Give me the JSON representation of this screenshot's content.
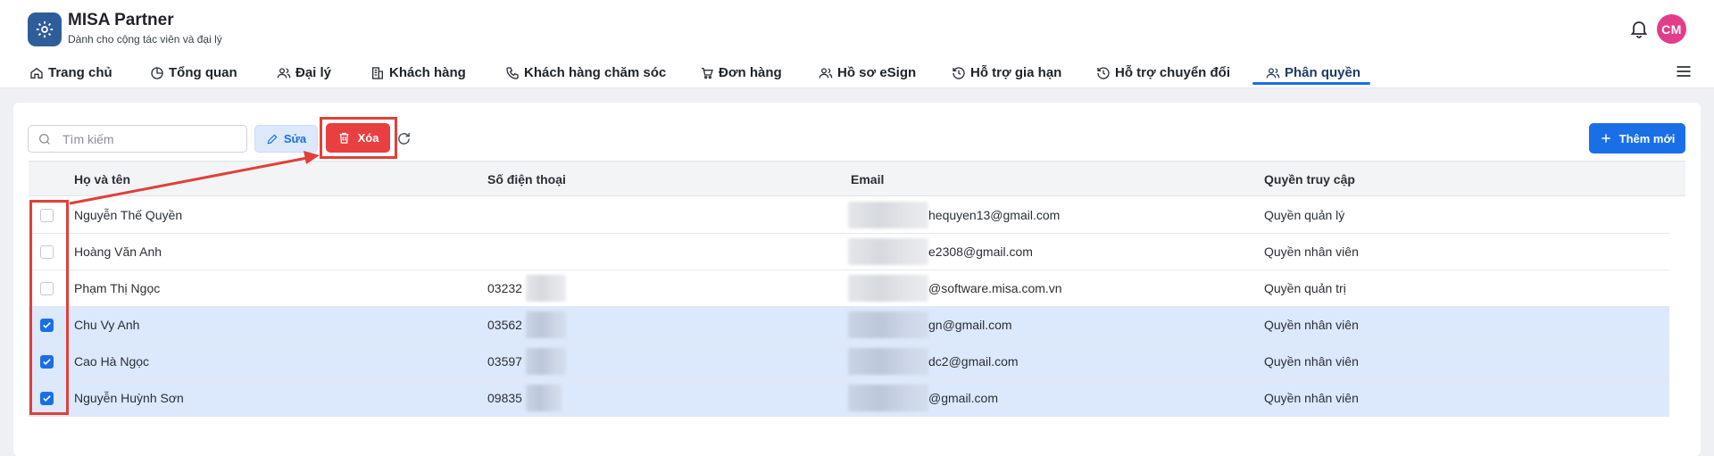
{
  "app": {
    "title": "MISA Partner",
    "subtitle": "Dành cho cộng tác viên và đại lý",
    "avatar_initials": "CM"
  },
  "nav": {
    "items": [
      {
        "label": "Trang chủ",
        "icon": "home-icon"
      },
      {
        "label": "Tổng quan",
        "icon": "pie-chart-icon"
      },
      {
        "label": "Đại lý",
        "icon": "users-icon"
      },
      {
        "label": "Khách hàng",
        "icon": "building-icon"
      },
      {
        "label": "Khách hàng chăm sóc",
        "icon": "phone-icon"
      },
      {
        "label": "Đơn hàng",
        "icon": "cart-icon"
      },
      {
        "label": "Hồ sơ eSign",
        "icon": "users-icon"
      },
      {
        "label": "Hỗ trợ gia hạn",
        "icon": "history-icon"
      },
      {
        "label": "Hỗ trợ chuyển đổi",
        "icon": "history-icon"
      },
      {
        "label": "Phân quyền",
        "icon": "users-icon"
      }
    ],
    "active": "Phân quyền"
  },
  "toolbar": {
    "search_placeholder": "Tìm kiếm",
    "edit_label": "Sửa",
    "delete_label": "Xóa",
    "add_label": "Thêm mới"
  },
  "table": {
    "columns": [
      "Họ và tên",
      "Số điện thoại",
      "Email",
      "Quyền truy cập"
    ],
    "rows": [
      {
        "selected": false,
        "name": "Nguyễn Thế Quyền",
        "phone": "",
        "email": "hequyen13@gmail.com",
        "role": "Quyền quản lý"
      },
      {
        "selected": false,
        "name": "Hoàng Văn Anh",
        "phone": "",
        "email": "e2308@gmail.com",
        "role": "Quyền nhân viên"
      },
      {
        "selected": false,
        "name": "Phạm Thị Ngọc",
        "phone": "03232",
        "email": "@software.misa.com.vn",
        "role": "Quyền quản trị"
      },
      {
        "selected": true,
        "name": "Chu Vy Anh",
        "phone": "03562",
        "email": "gn@gmail.com",
        "role": "Quyền nhân viên"
      },
      {
        "selected": true,
        "name": "Cao Hà Ngọc",
        "phone": "03597",
        "email": "dc2@gmail.com",
        "role": "Quyền nhân viên"
      },
      {
        "selected": true,
        "name": "Nguyễn Huỳnh Sơn",
        "phone": "09835",
        "email": "@gmail.com",
        "role": "Quyền nhân viên"
      }
    ]
  },
  "colors": {
    "accent": "#1a6fe8",
    "danger": "#e84040",
    "selected_row": "#dce8fb",
    "annotation": "#e0403a",
    "logo": "#2f5d9a",
    "avatar": "#e23d8a"
  }
}
